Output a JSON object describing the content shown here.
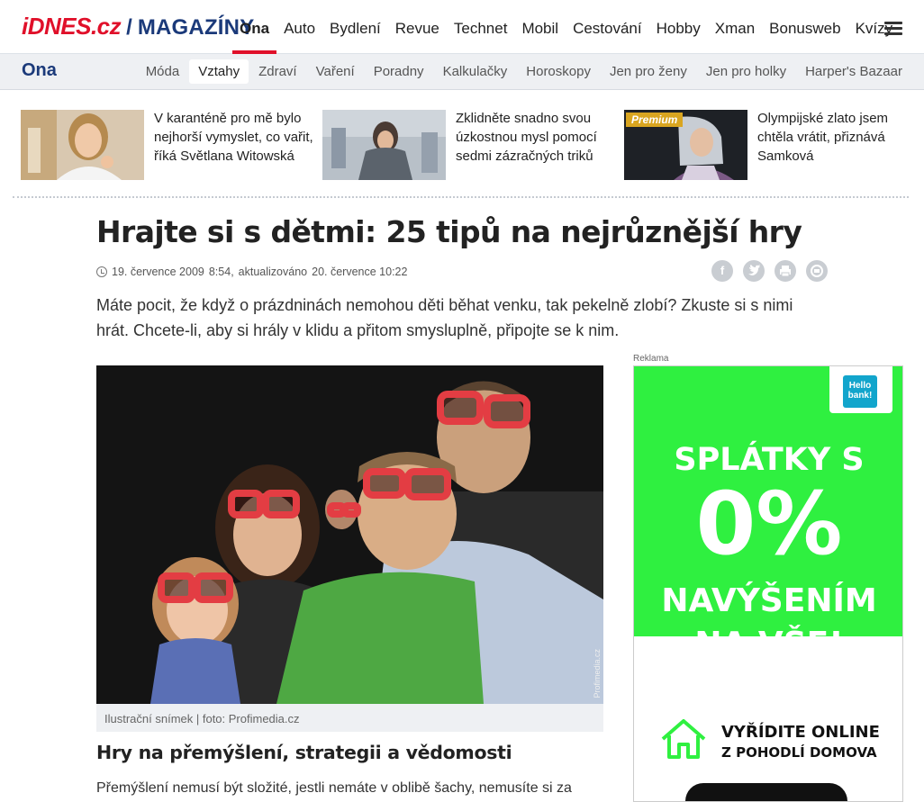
{
  "logo": {
    "brand": "iDNES.cz",
    "slash": "/",
    "section": "MAGAZÍNY"
  },
  "topnav": {
    "items": [
      {
        "label": "Ona"
      },
      {
        "label": "Auto"
      },
      {
        "label": "Bydlení"
      },
      {
        "label": "Revue"
      },
      {
        "label": "Technet"
      },
      {
        "label": "Mobil"
      },
      {
        "label": "Cestování"
      },
      {
        "label": "Hobby"
      },
      {
        "label": "Xman"
      },
      {
        "label": "Bonusweb"
      },
      {
        "label": "Kvízy"
      }
    ],
    "active_index": 0
  },
  "subnav": {
    "section_title": "Ona",
    "items": [
      {
        "label": "Móda"
      },
      {
        "label": "Vztahy"
      },
      {
        "label": "Zdraví"
      },
      {
        "label": "Vaření"
      },
      {
        "label": "Poradny"
      },
      {
        "label": "Kalkulačky"
      },
      {
        "label": "Horoskopy"
      },
      {
        "label": "Jen pro ženy"
      },
      {
        "label": "Jen pro holky"
      },
      {
        "label": "Harper's Bazaar"
      }
    ],
    "active_index": 1
  },
  "teasers": [
    {
      "title": "V karanténě pro mě bylo nejhorší vymyslet, co vařit, říká Světlana Witowská"
    },
    {
      "title": "Zklidněte snadno svou úzkostnou mysl pomocí sedmi zázračných triků"
    },
    {
      "title": "Olympijské zlato jsem chtěla vrátit, přiznává Samková",
      "badge": "Premium"
    }
  ],
  "article": {
    "headline": "Hrajte si s dětmi: 25 tipů na nejrůznější hry",
    "date": "19. července 2009",
    "time": "8:54,",
    "updated_label": "aktualizováno",
    "updated": "20. července 10:22",
    "perex": "Máte pocit, že když o prázdninách nemohou děti běhat venku, tak pekelně zlobí? Zkuste si s nimi hrát. Chcete-li, aby si hrály v klidu a přitom smysluplně, připojte se k nim.",
    "image_watermark": "Profimedia.cz",
    "image_caption": "Ilustrační snímek | foto: Profimedia.cz",
    "subheading": "Hry na přemýšlení, strategii a vědomosti",
    "body_start": "Přemýšlení nemusí být složité, jestli nemáte v oblibě šachy, nemusíte si za"
  },
  "share": {
    "icons": [
      "facebook-icon",
      "twitter-icon",
      "print-icon",
      "email-icon"
    ]
  },
  "ad": {
    "label": "Reklama",
    "logo_line1": "Hello",
    "logo_line2": "bank!",
    "line1": "SPLÁTKY S",
    "line2": "0%",
    "line3": "NAVÝŠENÍM",
    "line4": "NA VŠE!",
    "cta1": "VYŘÍDITE ONLINE",
    "cta2": "Z POHODLÍ DOMOVA",
    "colors": {
      "green": "#2ff040",
      "blue": "#12a5cc"
    }
  },
  "colors": {
    "brand_red": "#e0102a",
    "brand_blue": "#1b3a7a",
    "premium": "#d9a520"
  }
}
